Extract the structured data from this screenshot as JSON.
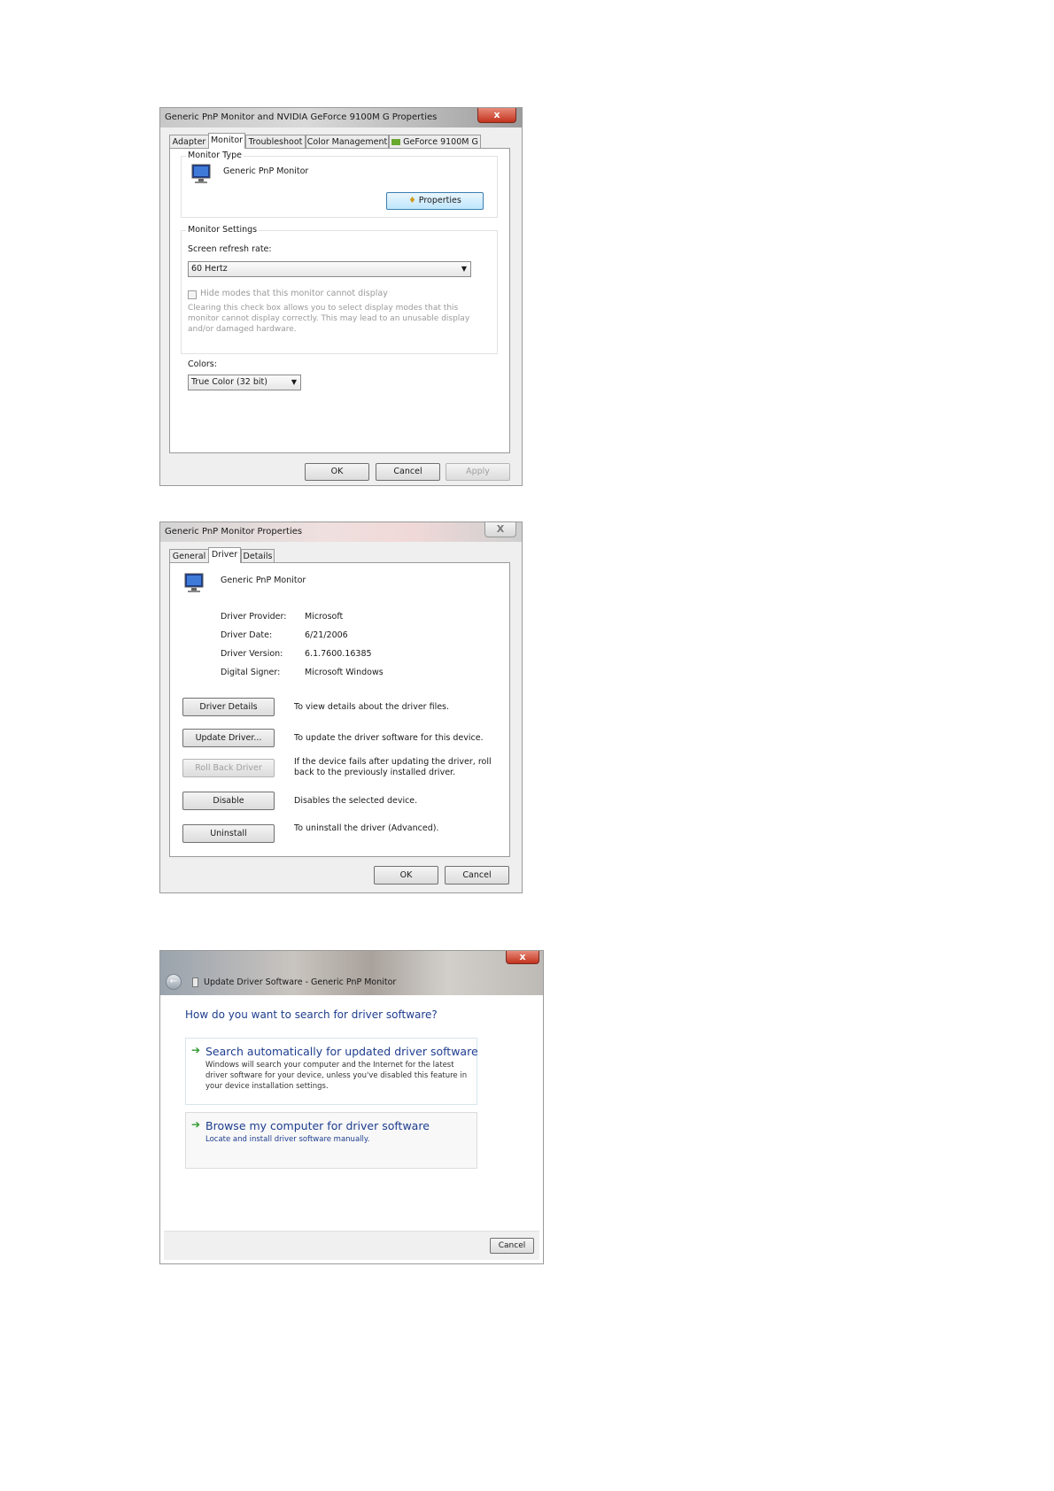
{
  "monitor_dialog": {
    "title": "Generic PnP Monitor and NVIDIA GeForce 9100M G   Properties",
    "close": "x",
    "tabs": [
      "Adapter",
      "Monitor",
      "Troubleshoot",
      "Color Management",
      "GeForce 9100M G"
    ],
    "active_tab": "Monitor",
    "monitor_type_label": "Monitor Type",
    "monitor_name": "Generic PnP Monitor",
    "properties_button": "Properties",
    "monitor_settings_label": "Monitor Settings",
    "refresh_rate_label": "Screen refresh rate:",
    "refresh_rate_value": "60 Hertz",
    "hide_modes_label": "Hide modes that this monitor cannot display",
    "hide_modes_desc": "Clearing this check box allows you to select display modes that this monitor cannot display correctly. This may lead to an unusable display and/or damaged hardware.",
    "colors_label": "Colors:",
    "colors_value": "True Color (32 bit)",
    "ok": "OK",
    "cancel": "Cancel",
    "apply": "Apply"
  },
  "driver_dialog": {
    "title": "Generic PnP Monitor Properties",
    "close": "X",
    "tabs": [
      "General",
      "Driver",
      "Details"
    ],
    "active_tab": "Driver",
    "device_name": "Generic PnP Monitor",
    "fields": [
      {
        "label": "Driver Provider:",
        "value": "Microsoft"
      },
      {
        "label": "Driver Date:",
        "value": "6/21/2006"
      },
      {
        "label": "Driver Version:",
        "value": "6.1.7600.16385"
      },
      {
        "label": "Digital Signer:",
        "value": "Microsoft Windows"
      }
    ],
    "actions": [
      {
        "button": "Driver Details",
        "desc": "To view details about the driver files.",
        "enabled": true
      },
      {
        "button": "Update Driver...",
        "desc": "To update the driver software for this device.",
        "enabled": true
      },
      {
        "button": "Roll Back Driver",
        "desc": "If the device fails after updating the driver, roll back to the previously installed driver.",
        "enabled": false
      },
      {
        "button": "Disable",
        "desc": "Disables the selected device.",
        "enabled": true
      },
      {
        "button": "Uninstall",
        "desc": "To uninstall the driver (Advanced).",
        "enabled": true
      }
    ],
    "ok": "OK",
    "cancel": "Cancel"
  },
  "update_wizard": {
    "title": "Update Driver Software - Generic PnP Monitor",
    "close": "x",
    "question": "How do you want to search for driver software?",
    "option1_title": "Search automatically for updated driver software",
    "option1_desc": "Windows will search your computer and the Internet for the latest driver software for your device, unless you've disabled this feature in your device installation settings.",
    "option2_title": "Browse my computer for driver software",
    "option2_desc": "Locate and install driver software manually.",
    "cancel": "Cancel"
  },
  "colors": {
    "link_blue": "#1e3d8f",
    "arrow_green": "#2e9a2e",
    "close_red": "#c2331e"
  }
}
